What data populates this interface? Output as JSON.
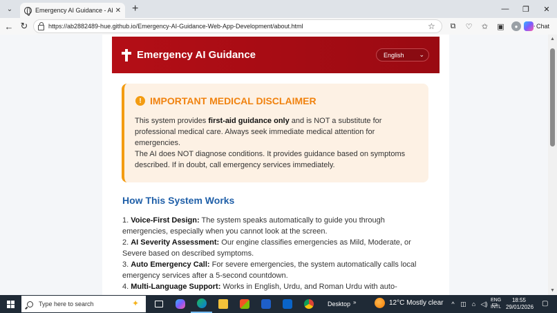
{
  "browser": {
    "tab_title": "Emergency AI Guidance - About & ...",
    "url": "https://ab2882489-hue.github.io/Emergency-AI-Guidance-Web-App-Development/about.html",
    "chat_label": "Chat"
  },
  "header": {
    "title": "Emergency AI Guidance",
    "language": "English"
  },
  "disclaimer": {
    "title": "IMPORTANT MEDICAL DISCLAIMER",
    "p1_pre": "This system provides ",
    "p1_bold": "first-aid guidance only",
    "p1_post": " and is NOT a substitute for professional medical care. Always seek immediate medical attention for emergencies.",
    "p2": "The AI does NOT diagnose conditions. It provides guidance based on symptoms described. If in doubt, call emergency services immediately."
  },
  "how": {
    "title": "How This System Works",
    "items": [
      {
        "num": "1. ",
        "label": "Voice-First Design:",
        "text": " The system speaks automatically to guide you through emergencies, especially when you cannot look at the screen."
      },
      {
        "num": "2. ",
        "label": "AI Severity Assessment:",
        "text": " Our engine classifies emergencies as Mild, Moderate, or Severe based on described symptoms."
      },
      {
        "num": "3. ",
        "label": "Auto Emergency Call:",
        "text": " For severe emergencies, the system automatically calls local emergency services after a 5-second countdown."
      },
      {
        "num": "4. ",
        "label": "Multi-Language Support:",
        "text": " Works in English, Urdu, and Roman Urdu with auto-"
      }
    ]
  },
  "taskbar": {
    "search_placeholder": "Type here to search",
    "desktop": "Desktop",
    "weather": "12°C  Mostly clear",
    "lang_line1": "ENG",
    "lang_line2": "INTL",
    "time": "18:55",
    "date": "29/01/2026"
  }
}
